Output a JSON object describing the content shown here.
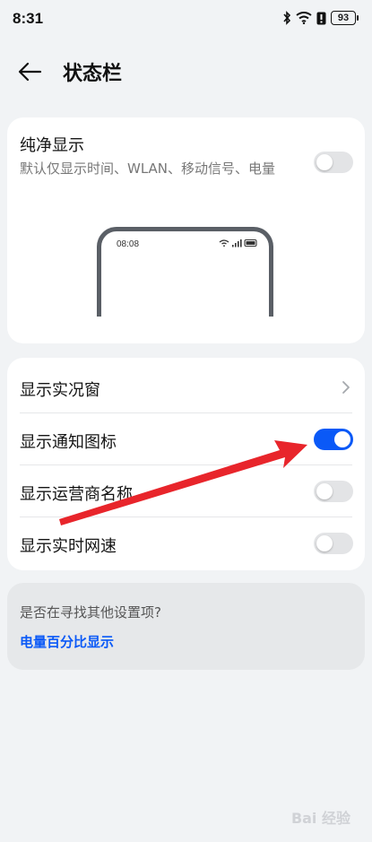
{
  "status_bar": {
    "time": "8:31",
    "battery": "93",
    "icons": [
      "bluetooth-icon",
      "wifi-icon",
      "alert-icon",
      "battery-icon"
    ]
  },
  "header": {
    "title": "状态栏",
    "back_icon": "back-arrow-icon"
  },
  "pure_display": {
    "title": "纯净显示",
    "description": "默认仅显示时间、WLAN、移动信号、电量",
    "enabled": false,
    "preview": {
      "time": "08:08"
    }
  },
  "settings": {
    "items": [
      {
        "label": "显示实况窗",
        "control": "chevron"
      },
      {
        "label": "显示通知图标",
        "control": "toggle",
        "enabled": true
      },
      {
        "label": "显示运营商名称",
        "control": "toggle",
        "enabled": false
      },
      {
        "label": "显示实时网速",
        "control": "toggle",
        "enabled": false
      }
    ]
  },
  "search_suggestion": {
    "hint": "是否在寻找其他设置项?",
    "link": "电量百分比显示"
  },
  "annotation": {
    "arrow_color": "#e8252b"
  },
  "watermark": "Bai 经验",
  "colors": {
    "accent": "#0a59f7",
    "background": "#f1f3f5"
  }
}
